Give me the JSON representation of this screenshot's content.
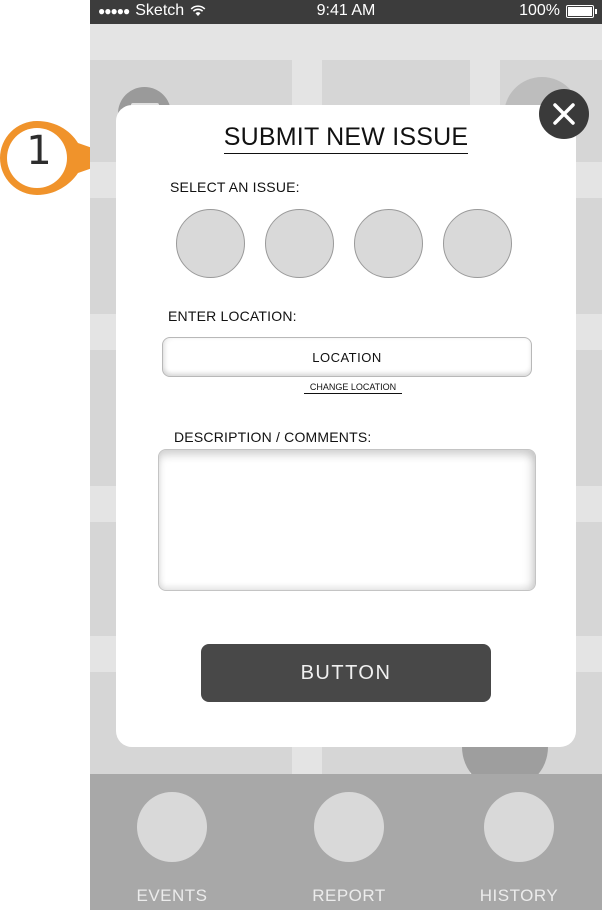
{
  "status_bar": {
    "carrier": "Sketch",
    "time": "9:41 AM",
    "battery": "100%",
    "battery_level": 1.0,
    "signal_icon": "signal-dots-icon",
    "wifi_icon": "wifi-icon",
    "battery_icon": "battery-icon"
  },
  "annotation": {
    "number": "1",
    "color": "#f0932b"
  },
  "modal": {
    "title": "SUBMIT NEW ISSUE",
    "close_icon": "close-icon",
    "select_issue_label": "SELECT AN ISSUE:",
    "issue_options": [
      "",
      "",
      "",
      ""
    ],
    "enter_location_label": "ENTER LOCATION:",
    "location_value": "LOCATION",
    "change_location_link": "CHANGE LOCATION",
    "description_label": "DESCRIPTION / COMMENTS:",
    "description_value": "",
    "submit_button": "BUTTON"
  },
  "tab_bar": {
    "tabs": [
      {
        "label": "EVENTS"
      },
      {
        "label": "REPORT"
      },
      {
        "label": "HISTORY"
      }
    ]
  },
  "colors": {
    "status_bar": "#3c3c3c",
    "map": "#d6d6d6",
    "tab_bar": "#a8a8a8",
    "button": "#484848",
    "accent": "#f0932b"
  }
}
